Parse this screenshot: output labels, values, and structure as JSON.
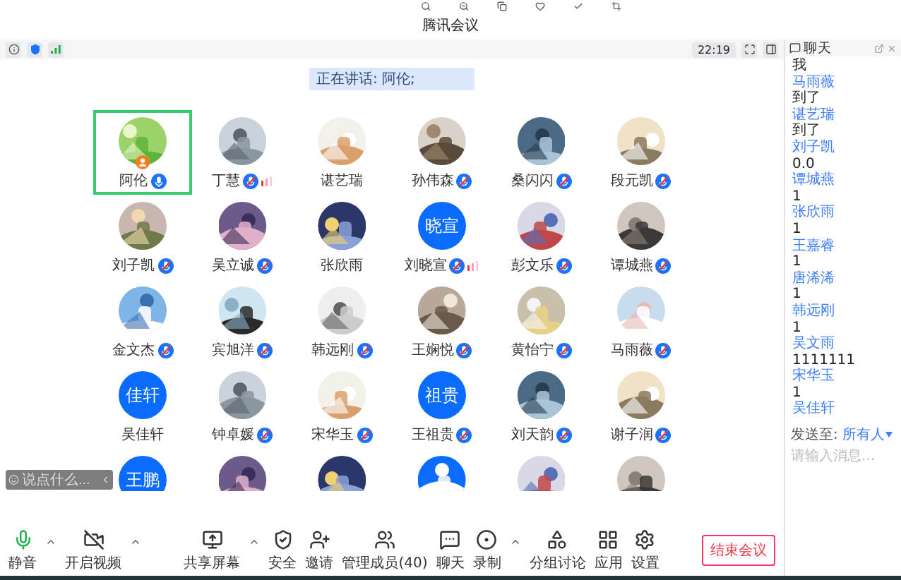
{
  "window": {
    "title": "腾讯会议"
  },
  "info_bar": {
    "time": "22:19"
  },
  "speaking_banner": "正在讲话: 阿伦;",
  "participants": [
    {
      "name": "阿伦",
      "avatar": {
        "kind": "picture"
      },
      "mic": {
        "muted": false
      },
      "speaking": false,
      "host": true,
      "selected": true
    },
    {
      "name": "丁慧",
      "avatar": {
        "kind": "picture"
      },
      "mic": {
        "muted": true
      },
      "speaking": true,
      "host": false,
      "selected": false
    },
    {
      "name": "谌艺瑞",
      "avatar": {
        "kind": "picture"
      },
      "speaking": false,
      "host": false,
      "selected": false
    },
    {
      "name": "孙伟森",
      "avatar": {
        "kind": "picture"
      },
      "mic": {
        "muted": true
      },
      "speaking": false,
      "host": false,
      "selected": false
    },
    {
      "name": "桑闪闪",
      "avatar": {
        "kind": "picture"
      },
      "mic": {
        "muted": true
      },
      "speaking": false,
      "host": false,
      "selected": false
    },
    {
      "name": "段元凯",
      "avatar": {
        "kind": "picture"
      },
      "mic": {
        "muted": true
      },
      "speaking": false,
      "host": false,
      "selected": false
    },
    {
      "name": "刘子凯",
      "avatar": {
        "kind": "picture"
      },
      "mic": {
        "muted": true
      },
      "speaking": false,
      "host": false,
      "selected": false
    },
    {
      "name": "吴立诚",
      "avatar": {
        "kind": "picture"
      },
      "mic": {
        "muted": true
      },
      "speaking": false,
      "host": false,
      "selected": false
    },
    {
      "name": "张欣雨",
      "avatar": {
        "kind": "picture"
      },
      "speaking": false,
      "host": false,
      "selected": false
    },
    {
      "name": "刘晓宣",
      "avatar": {
        "kind": "text",
        "text": "晓宣"
      },
      "mic": {
        "muted": true
      },
      "speaking": true,
      "host": false,
      "selected": false
    },
    {
      "name": "彭文乐",
      "avatar": {
        "kind": "picture"
      },
      "mic": {
        "muted": true
      },
      "speaking": false,
      "host": false,
      "selected": false
    },
    {
      "name": "谭城燕",
      "avatar": {
        "kind": "picture"
      },
      "mic": {
        "muted": true
      },
      "speaking": false,
      "host": false,
      "selected": false
    },
    {
      "name": "金文杰",
      "avatar": {
        "kind": "picture"
      },
      "mic": {
        "muted": true
      },
      "speaking": false,
      "host": false,
      "selected": false
    },
    {
      "name": "宾旭洋",
      "avatar": {
        "kind": "picture"
      },
      "mic": {
        "muted": true
      },
      "speaking": false,
      "host": false,
      "selected": false
    },
    {
      "name": "韩远刚",
      "avatar": {
        "kind": "picture"
      },
      "mic": {
        "muted": true
      },
      "speaking": false,
      "host": false,
      "selected": false
    },
    {
      "name": "王娴悦",
      "avatar": {
        "kind": "picture"
      },
      "mic": {
        "muted": true
      },
      "speaking": false,
      "host": false,
      "selected": false
    },
    {
      "name": "黄怡宁",
      "avatar": {
        "kind": "picture"
      },
      "mic": {
        "muted": true
      },
      "speaking": false,
      "host": false,
      "selected": false
    },
    {
      "name": "马雨薇",
      "avatar": {
        "kind": "picture"
      },
      "mic": {
        "muted": true
      },
      "speaking": false,
      "host": false,
      "selected": false
    },
    {
      "name": "吴佳轩",
      "avatar": {
        "kind": "text",
        "text": "佳轩"
      },
      "speaking": false,
      "host": false,
      "selected": false
    },
    {
      "name": "钟卓媛",
      "avatar": {
        "kind": "picture"
      },
      "mic": {
        "muted": true
      },
      "speaking": false,
      "host": false,
      "selected": false
    },
    {
      "name": "宋华玉",
      "avatar": {
        "kind": "picture"
      },
      "mic": {
        "muted": true
      },
      "speaking": false,
      "host": false,
      "selected": false
    },
    {
      "name": "王祖贵",
      "avatar": {
        "kind": "text",
        "text": "祖贵"
      },
      "mic": {
        "muted": true
      },
      "speaking": false,
      "host": false,
      "selected": false
    },
    {
      "name": "刘天韵",
      "avatar": {
        "kind": "picture"
      },
      "mic": {
        "muted": true
      },
      "speaking": false,
      "host": false,
      "selected": false
    },
    {
      "name": "谢子润",
      "avatar": {
        "kind": "picture"
      },
      "mic": {
        "muted": true
      },
      "speaking": false,
      "host": false,
      "selected": false
    },
    {
      "avatar": {
        "kind": "text",
        "text": "王鹏"
      }
    },
    {
      "avatar": {
        "kind": "picture"
      }
    },
    {
      "avatar": {
        "kind": "picture"
      }
    },
    {
      "avatar": {
        "kind": "picture"
      }
    },
    {
      "avatar": {
        "kind": "picture"
      }
    },
    {
      "avatar": {
        "kind": "picture"
      }
    }
  ],
  "comment_chip": {
    "placeholder": "说点什么..."
  },
  "toolbar_left": [
    {
      "kind": "mic",
      "label": "静音",
      "menu": true
    },
    {
      "kind": "video-off",
      "label": "开启视频",
      "menu": true
    }
  ],
  "toolbar_center": [
    {
      "kind": "share",
      "label": "共享屏幕",
      "menu": true
    },
    {
      "kind": "security",
      "label": "安全",
      "menu": false
    },
    {
      "kind": "invite",
      "label": "邀请",
      "menu": false
    },
    {
      "kind": "members",
      "label": "管理成员(40)",
      "menu": false
    },
    {
      "kind": "chat",
      "label": "聊天",
      "menu": false
    },
    {
      "kind": "record",
      "label": "录制",
      "menu": true
    },
    {
      "kind": "breakout",
      "label": "分组讨论",
      "menu": false
    },
    {
      "kind": "apps",
      "label": "应用",
      "menu": false
    },
    {
      "kind": "settings",
      "label": "设置",
      "menu": false
    }
  ],
  "end_button": "结束会议",
  "chat": {
    "title": "聊天",
    "messages": [
      {
        "kind": "message",
        "text": "我"
      },
      {
        "kind": "sender",
        "text": "马雨薇"
      },
      {
        "kind": "message",
        "text": "到了"
      },
      {
        "kind": "sender",
        "text": "谌艺瑞"
      },
      {
        "kind": "message",
        "text": "到了"
      },
      {
        "kind": "sender",
        "text": "刘子凯"
      },
      {
        "kind": "message",
        "text": "0.0"
      },
      {
        "kind": "sender",
        "text": "谭城燕"
      },
      {
        "kind": "message",
        "text": "1"
      },
      {
        "kind": "sender",
        "text": "张欣雨"
      },
      {
        "kind": "message",
        "text": "1"
      },
      {
        "kind": "sender",
        "text": "王嘉睿"
      },
      {
        "kind": "message",
        "text": "1"
      },
      {
        "kind": "sender",
        "text": "唐浠浠"
      },
      {
        "kind": "message",
        "text": "1"
      },
      {
        "kind": "sender",
        "text": "韩远刚"
      },
      {
        "kind": "message",
        "text": "1"
      },
      {
        "kind": "sender",
        "text": "吴文雨"
      },
      {
        "kind": "message",
        "text": "1111111"
      },
      {
        "kind": "sender",
        "text": "宋华玉"
      },
      {
        "kind": "message",
        "text": "1"
      },
      {
        "kind": "sender",
        "text": "吴佳轩"
      }
    ],
    "send_to_label": "发送至:",
    "send_to": "所有人",
    "placeholder": "请输入消息..."
  }
}
